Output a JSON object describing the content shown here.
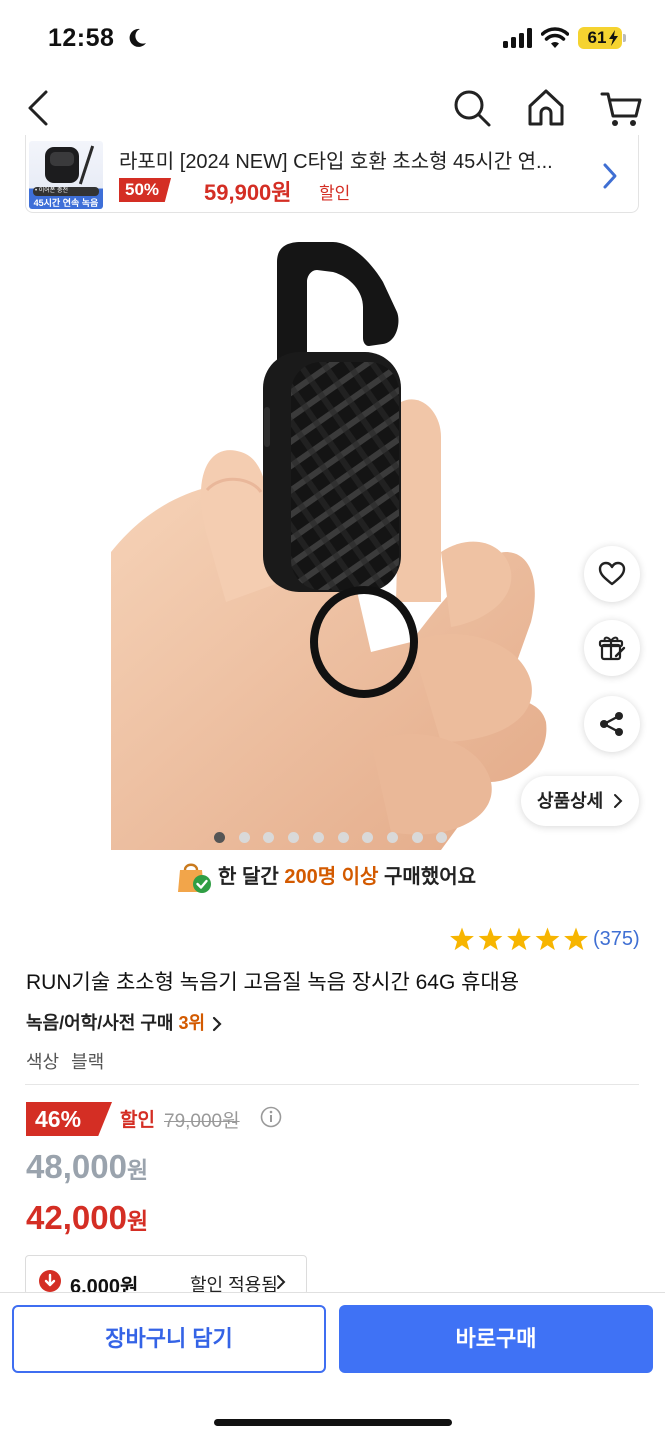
{
  "status_bar": {
    "time": "12:58",
    "battery": "61",
    "icons": [
      "moon-icon",
      "signal-icon",
      "wifi-icon",
      "battery-icon"
    ]
  },
  "nav": {
    "icons": [
      "back-icon",
      "search-icon",
      "home-icon",
      "cart-icon"
    ]
  },
  "banner": {
    "thumb_caption": "• 이어폰 충전",
    "thumb_strip": "45시간 연속 녹음",
    "title": "라포미 [2024 NEW] C타입 호환 초소형 45시간 연...",
    "rate": "50%",
    "price": "59,900원",
    "discount_label": "할인"
  },
  "gallery": {
    "dot_count": 10,
    "active_index": 0,
    "detail_button": "상품상세"
  },
  "buyers": {
    "prefix": "한 달간",
    "highlight": "200명 이상",
    "suffix": "구매했어요"
  },
  "product": {
    "rating": 5,
    "review_count": "(375)",
    "name": "RUN기술 초소형 녹음기 고음질 녹음 장시간 64G 휴대용",
    "category": "녹음/어학/사전 구매",
    "rank": "3위",
    "option_label": "색상",
    "option_value": "블랙"
  },
  "price": {
    "rate": "46%",
    "discount_label": "할인",
    "original": "79,000원",
    "base_number": "48,000",
    "final_number": "42,000",
    "won": "원",
    "coupon_amount": "6,000원",
    "coupon_text": "할인 적용됨"
  },
  "actions": {
    "cart": "장바구니 담기",
    "buy": "바로구매"
  },
  "colors": {
    "accent_blue": "#3f72f5",
    "sale_red": "#d42e24",
    "rank_orange": "#d35a00",
    "star_yellow": "#f7b500"
  }
}
